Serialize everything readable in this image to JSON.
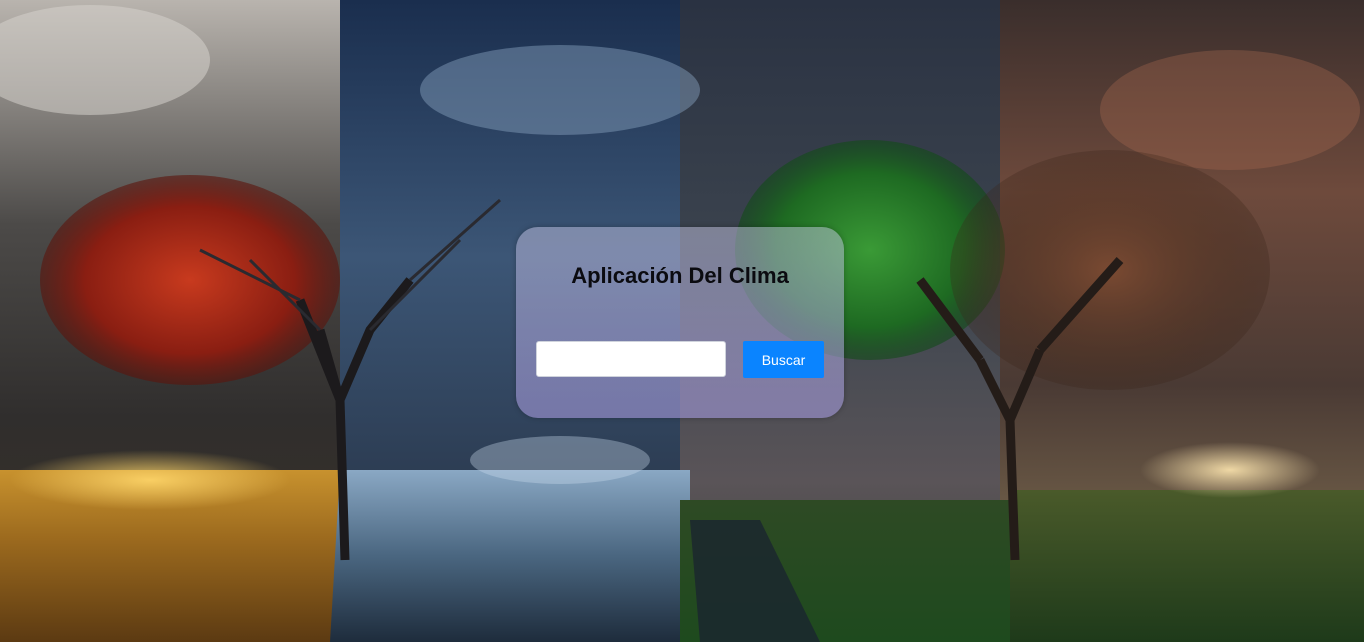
{
  "app": {
    "title": "Aplicación Del Clima"
  },
  "search": {
    "value": "",
    "placeholder": "",
    "button_label": "Buscar"
  },
  "theme": {
    "button_color": "#0a84ff",
    "title_color": "#0b0b10"
  }
}
